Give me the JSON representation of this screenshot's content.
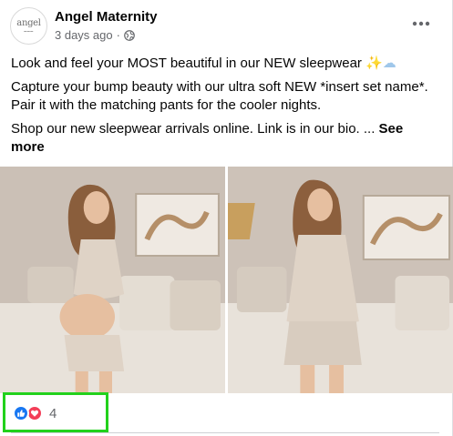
{
  "post": {
    "page_name": "Angel Maternity",
    "avatar_logo_text": "angel",
    "timestamp": "3 days ago",
    "separator": "·",
    "privacy_icon": "globe-icon",
    "more_icon": "more-options-icon",
    "paragraph_1": "Look and feel your MOST beautiful in our NEW sleepwear",
    "paragraph_1_emojis": [
      "✨",
      "☁"
    ],
    "paragraph_2": "Capture your bump beauty with our ultra soft NEW *insert set name*. Pair it with the matching pants for the cooler nights.",
    "paragraph_3": "Shop our new sleepwear arrivals online. Link is in our bio. ...",
    "see_more": "See more"
  },
  "photos": [
    {
      "name": "photo-1"
    },
    {
      "name": "photo-2"
    }
  ],
  "reactions": {
    "icons": [
      "like-icon",
      "love-icon"
    ],
    "count": "4"
  },
  "colors": {
    "like": "#1877f2",
    "love": "#f33e58",
    "highlight": "#22d11c",
    "secondary_text": "#65676b"
  }
}
